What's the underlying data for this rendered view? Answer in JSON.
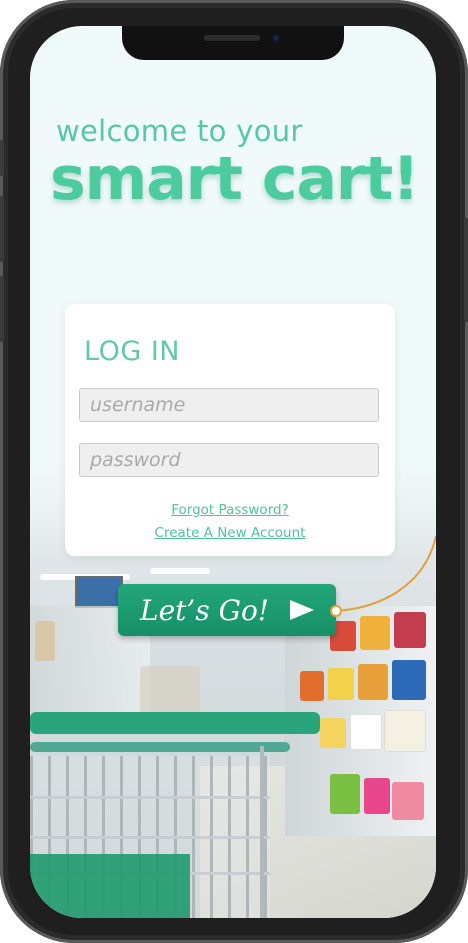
{
  "header": {
    "welcome_text": "welcome to your",
    "brand_text": "smart cart!"
  },
  "login": {
    "title": "LOG IN",
    "username_placeholder": "username",
    "password_placeholder": "password",
    "forgot_password": "Forgot Password?",
    "create_account": "Create A New Account"
  },
  "go_button": {
    "label": "Let’s Go!",
    "icon": "play-arrow-icon"
  },
  "colors": {
    "accent": "#4ccb9f",
    "button": "#1f9d72",
    "connector": "#e0a23a"
  }
}
